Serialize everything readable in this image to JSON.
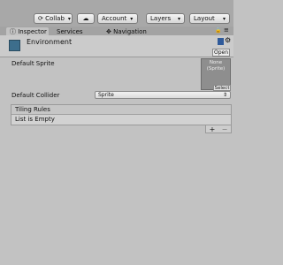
{
  "toolbar": {
    "collab_label": "Collab",
    "cloud_icon": "cloud-icon",
    "account_label": "Account",
    "layers_label": "Layers",
    "layout_label": "Layout"
  },
  "tabs": [
    {
      "label": "Inspector",
      "icon": "info-icon",
      "active": true
    },
    {
      "label": "Services",
      "active": false
    },
    {
      "label": "Navigation",
      "icon": "navigation-icon",
      "active": false
    }
  ],
  "inspector": {
    "object_name": "Environment",
    "open_label": "Open",
    "fields": {
      "default_sprite_label": "Default Sprite",
      "sprite_preview_text": "None\n(Sprite)",
      "select_label": "Select",
      "default_collider_label": "Default Collider",
      "default_collider_value": "Sprite"
    },
    "tiling_rules": {
      "title": "Tiling Rules",
      "empty_text": "List is Empty",
      "add_symbol": "+",
      "remove_symbol": "−"
    }
  }
}
